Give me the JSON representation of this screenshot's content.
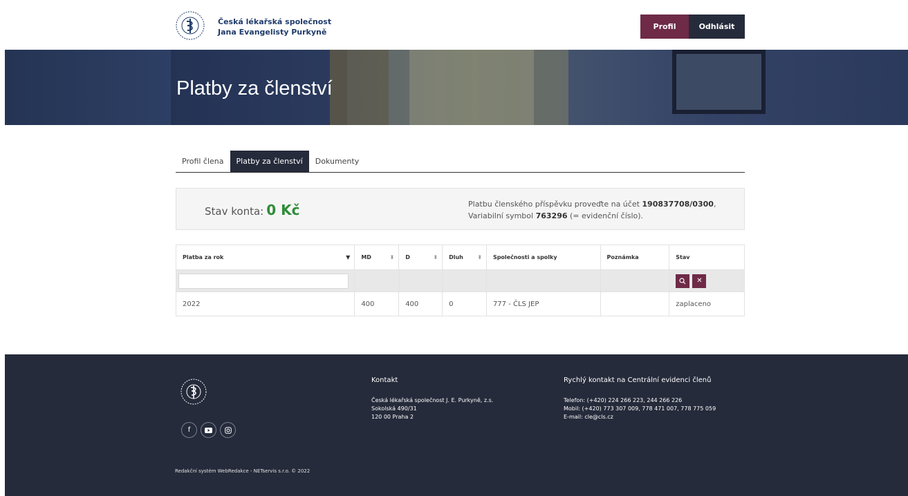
{
  "header": {
    "brand_line1": "Česká lékařská společnost",
    "brand_line2": "Jana Evangelisty Purkyně",
    "profile_button": "Profil",
    "logout_button": "Odhlásit"
  },
  "hero": {
    "title": "Platby za členství"
  },
  "tabs": [
    {
      "label": "Profil člena",
      "active": false
    },
    {
      "label": "Platby za členství",
      "active": true
    },
    {
      "label": "Dokumenty",
      "active": false
    }
  ],
  "account": {
    "balance_label": "Stav konta:",
    "balance_value": "0 Kč",
    "info_line1_prefix": "Platbu členského příspěvku proveďte na účet",
    "account_number": "190837708/0300",
    "info_line1_suffix": ",",
    "info_line2_prefix": "Variabilní symbol",
    "variable_symbol": "763296",
    "info_line2_suffix": "(= evidenční číslo)."
  },
  "table": {
    "columns": [
      "Platba za rok",
      "MD",
      "D",
      "Dluh",
      "Společnosti a spolky",
      "Poznámka",
      "Stav"
    ],
    "filter_placeholder": "",
    "rows": [
      [
        "2022",
        "400",
        "400",
        "0",
        "777 - ČLS JEP",
        "",
        "zaplaceno"
      ]
    ]
  },
  "footer": {
    "contact_heading": "Kontakt",
    "contact_line1": "Česká lékařská společnost J. E. Purkyně, z.s.",
    "contact_line2": "Sokolská 490/31",
    "contact_line3": "120 00 Praha 2",
    "quick_heading": "Rychlý kontakt na Centrální evidenci členů",
    "quick_line1": "Telefon: (+420) 224 266 223, 244 266 226",
    "quick_line2": "Mobil: (+420) 773 307 009, 778 471 007, 778 775 059",
    "quick_line3": "E-mail: cle@cls.cz",
    "copyright": "Redakční systém WebRedakce - NETservis s.r.o. © 2022"
  },
  "colors": {
    "accent": "#6e2a47",
    "dark": "#262b3b",
    "balance_green": "#2f8c3a"
  }
}
